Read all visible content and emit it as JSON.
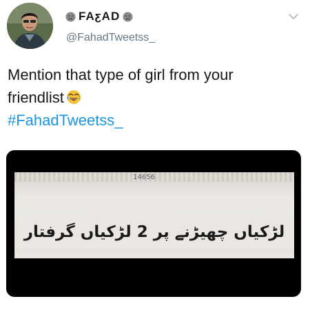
{
  "tweet": {
    "display_name": "FAƹAD",
    "handle": "@FahadTweetss_",
    "text_line1": "Mention that type of girl from your",
    "text_line2": "friendlist",
    "hashtag": "#FahadTweetss_"
  },
  "media": {
    "clipping_number": "14656",
    "headline_urdu": "لڑکیاں چھیڑنے پر 2 لڑکیاں گرفتار"
  },
  "icons": {
    "name_left": "neutral-face-icon",
    "name_right": "neutral-face-icon",
    "text_emoji": "tears-of-joy-icon",
    "menu": "chevron-down-icon"
  },
  "colors": {
    "hashtag": "#1b95e0",
    "handle": "#657786",
    "text": "#14171a",
    "media_bg": "#000000"
  }
}
